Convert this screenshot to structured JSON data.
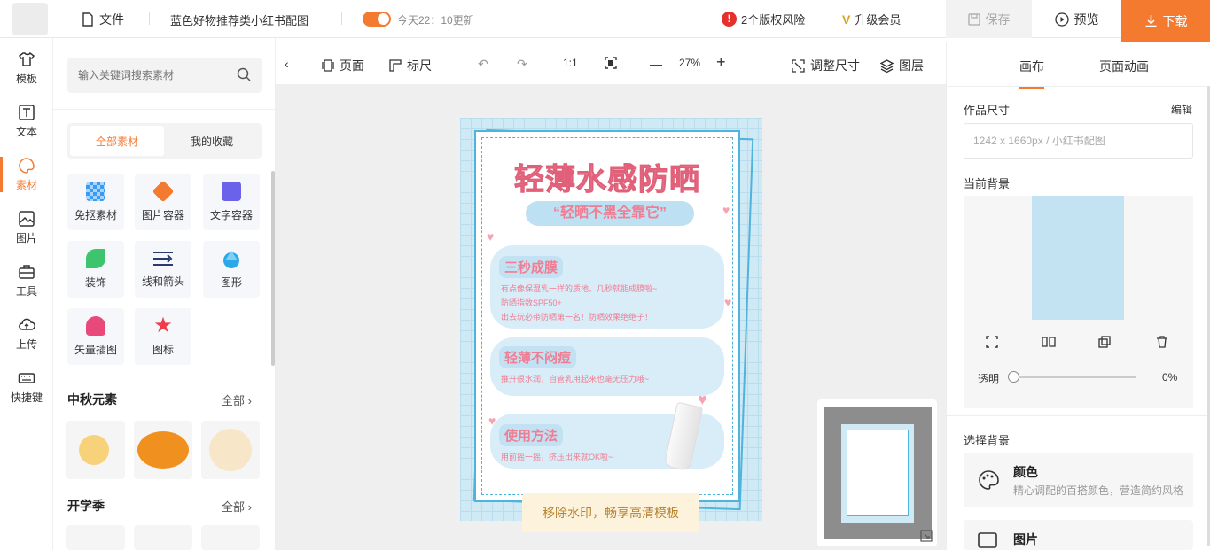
{
  "topbar": {
    "file_label": "文件",
    "doc_title": "蓝色好物推荐类小红书配图",
    "save_time": "今天22：10更新",
    "risk": "2个版权风险",
    "vip": "升级会员",
    "save": "保存",
    "preview": "预览",
    "download": "下载"
  },
  "leftnav": {
    "items": [
      {
        "label": "模板",
        "icon": "tshirt-icon"
      },
      {
        "label": "文本",
        "icon": "text-icon"
      },
      {
        "label": "素材",
        "icon": "palette-icon"
      },
      {
        "label": "图片",
        "icon": "image-icon"
      },
      {
        "label": "工具",
        "icon": "toolbox-icon"
      },
      {
        "label": "上传",
        "icon": "cloud-upload-icon"
      },
      {
        "label": "快捷键",
        "icon": "keyboard-icon"
      }
    ],
    "active_index": 2
  },
  "assets": {
    "search_placeholder": "输入关键词搜索素材",
    "tab_all": "全部素材",
    "tab_fav": "我的收藏",
    "tiles": [
      {
        "label": "免抠素材",
        "color": "#3a9bf0"
      },
      {
        "label": "图片容器",
        "color": "#f47a30"
      },
      {
        "label": "文字容器",
        "color": "#6a62e8"
      },
      {
        "label": "装饰",
        "color": "#3fc46e"
      },
      {
        "label": "线和箭头",
        "color": "#2b3a6e"
      },
      {
        "label": "图形",
        "color": "#2aa8e8"
      },
      {
        "label": "矢量插图",
        "color": "#e8487a"
      },
      {
        "label": "图标",
        "color": "#f03c4a"
      }
    ],
    "section1": "中秋元素",
    "section2": "开学季",
    "all_label": "全部"
  },
  "canvas_toolbar": {
    "page": "页面",
    "ruler": "标尺",
    "ratio": "1:1",
    "zoom": "27%",
    "resize": "调整尺寸",
    "layers": "图层"
  },
  "poster": {
    "title": "轻薄水感防晒",
    "subtitle": "“轻晒不黑全靠它”",
    "s1_head": "三秒成膜",
    "s1_lines": [
      "有点像保湿乳一样的质地，几秒就能成膜啦~",
      "防晒指数SPF50+",
      "出去玩必带防晒第一名！防晒效果绝绝子！"
    ],
    "s2_head": "轻薄不闷痘",
    "s2_lines": [
      "推开很水润，自管乳用起来也毫无压力哦~"
    ],
    "s3_head": "使用方法",
    "s3_lines": [
      "用前摇一摇，挤压出来就OK啦~"
    ]
  },
  "watermark": "移除水印，畅享高清模板",
  "rpanel": {
    "tab_canvas": "画布",
    "tab_anim": "页面动画",
    "size_label": "作品尺寸",
    "edit": "编辑",
    "size_value": "1242 x 1660px   / 小红书配图",
    "current_bg": "当前背景",
    "opacity_label": "透明",
    "opacity_value": "0%",
    "choose_bg": "选择背景",
    "color_title": "颜色",
    "color_desc": "精心调配的百搭颜色，营造简约风格",
    "image_title": "图片"
  },
  "colors": {
    "accent": "#f47a30",
    "poster_pink": "#f07d92",
    "poster_blue": "#cfe9f5"
  }
}
